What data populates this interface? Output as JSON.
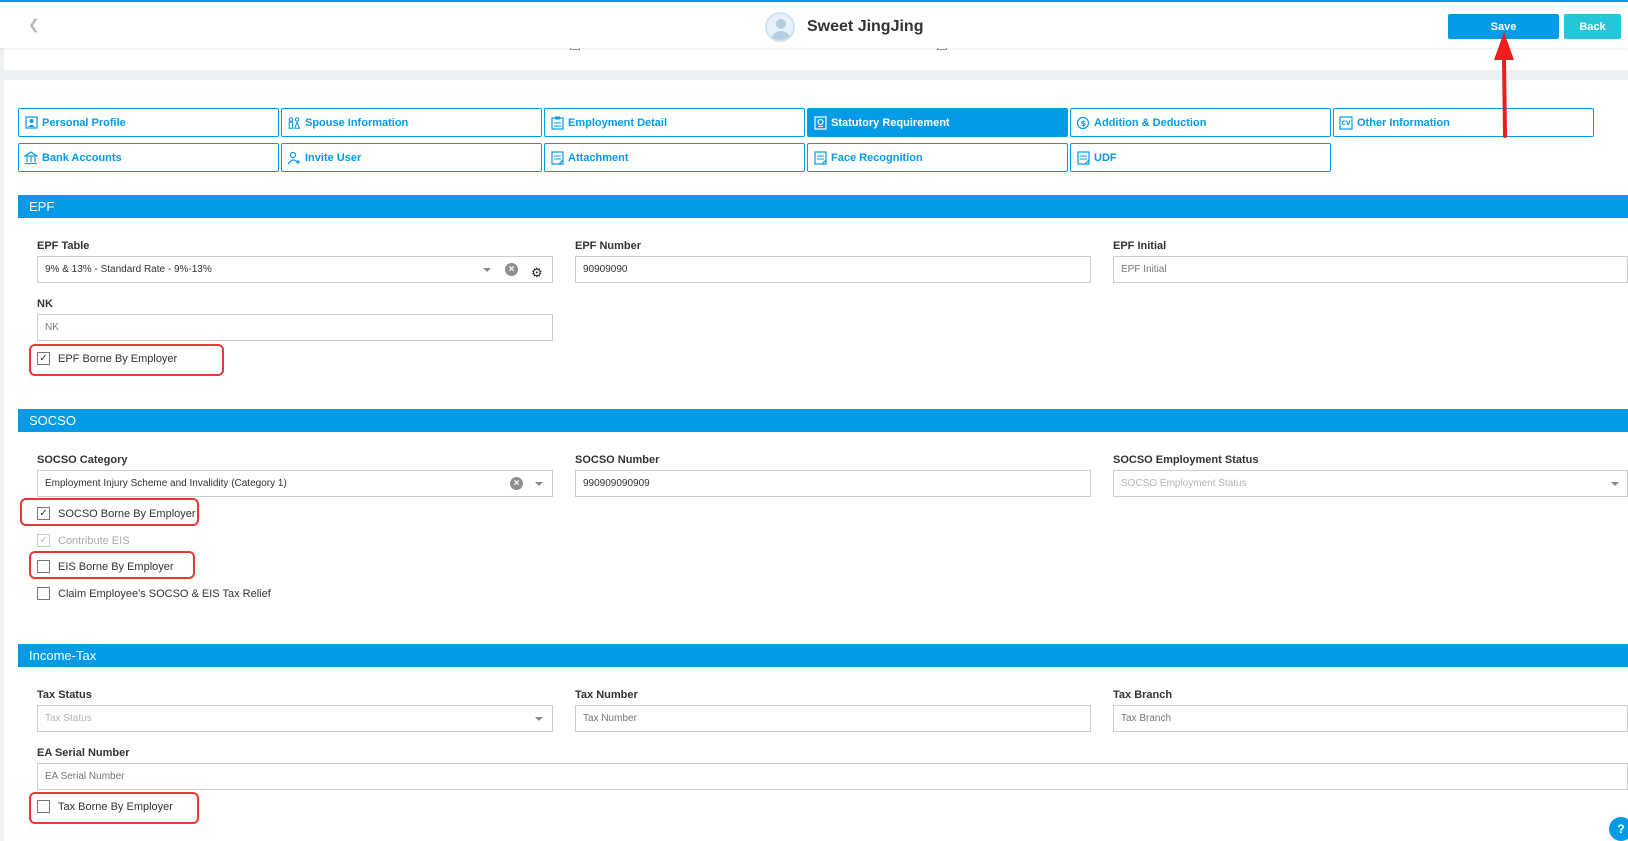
{
  "header": {
    "title": "Sweet JingJing",
    "save_label": "Save",
    "back_label": "Back"
  },
  "tabs": [
    {
      "label": "Personal Profile",
      "icon": "person-icon"
    },
    {
      "label": "Spouse Information",
      "icon": "couple-icon"
    },
    {
      "label": "Employment Detail",
      "icon": "clipboard-icon"
    },
    {
      "label": "Statutory Requirement",
      "icon": "badge-icon",
      "active": true
    },
    {
      "label": "Addition & Deduction",
      "icon": "money-icon"
    },
    {
      "label": "Other Information",
      "icon": "cv-icon"
    },
    {
      "label": "Bank Accounts",
      "icon": "bank-icon"
    },
    {
      "label": "Invite User",
      "icon": "add-user-icon"
    },
    {
      "label": "Attachment",
      "icon": "document-icon"
    },
    {
      "label": "Face Recognition",
      "icon": "document-icon"
    },
    {
      "label": "UDF",
      "icon": "document-icon"
    }
  ],
  "epf": {
    "section_title": "EPF",
    "table_label": "EPF Table",
    "table_value": "9% & 13% - Standard Rate - 9%-13%",
    "number_label": "EPF Number",
    "number_value": "90909090",
    "initial_label": "EPF Initial",
    "initial_placeholder": "EPF Initial",
    "nk_label": "NK",
    "nk_placeholder": "NK",
    "borne_label": "EPF Borne By Employer",
    "borne_checked": true
  },
  "socso": {
    "section_title": "SOCSO",
    "category_label": "SOCSO Category",
    "category_value": "Employment Injury Scheme and Invalidity (Category 1)",
    "number_label": "SOCSO Number",
    "number_value": "990909090909",
    "status_label": "SOCSO Employment Status",
    "status_placeholder": "SOCSO Employment Status",
    "borne_label": "SOCSO Borne By Employer",
    "borne_checked": true,
    "eis_label": "Contribute EIS",
    "eis_checked": true,
    "eis_borne_label": "EIS Borne By Employer",
    "eis_borne_checked": false,
    "relief_label": "Claim Employee's SOCSO & EIS Tax Relief",
    "relief_checked": false
  },
  "tax": {
    "section_title": "Income-Tax",
    "status_label": "Tax Status",
    "status_placeholder": "Tax Status",
    "number_label": "Tax Number",
    "number_placeholder": "Tax Number",
    "branch_label": "Tax Branch",
    "branch_placeholder": "Tax Branch",
    "ea_label": "EA Serial Number",
    "ea_placeholder": "EA Serial Number",
    "borne_label": "Tax Borne By Employer",
    "borne_checked": false
  },
  "colors": {
    "primary": "#039be5",
    "back_button": "#26c6da",
    "highlight": "#e53935"
  }
}
